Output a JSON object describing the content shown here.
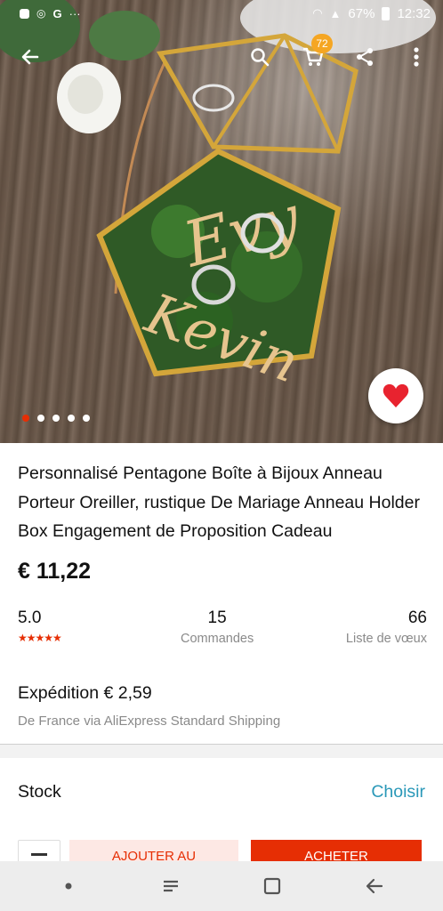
{
  "status_bar": {
    "battery": "67%",
    "time": "12:32"
  },
  "toolbar": {
    "cart_count": "72"
  },
  "gallery": {
    "image_count": 5,
    "active_index": 0
  },
  "product": {
    "title": "Personnalisé Pentagone Boîte à Bijoux Anneau Porteur Oreiller, rustique De Mariage Anneau Holder Box Engagement de Proposition Cadeau",
    "price": "€ 11,22"
  },
  "stats": {
    "rating": "5.0",
    "rating_stars": "★★★★★",
    "orders_value": "15",
    "orders_label": "Commandes",
    "wishlist_value": "66",
    "wishlist_label": "Liste de vœux"
  },
  "shipping": {
    "title": "Expédition € 2,59",
    "subtitle": "De France via AliExpress Standard Shipping"
  },
  "stock": {
    "label": "Stock",
    "action": "Choisir"
  },
  "actions": {
    "add_to_cart": "AJOUTER AU",
    "buy": "ACHETER"
  },
  "colors": {
    "accent_red": "#e62e04",
    "link_blue": "#2a98b8",
    "badge_orange": "#f5a623"
  }
}
